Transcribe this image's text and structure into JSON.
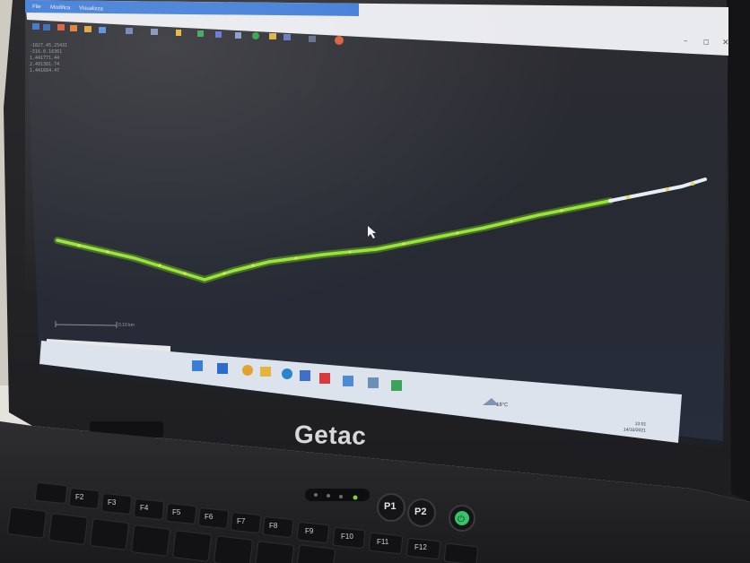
{
  "laptop": {
    "brand": "Getac",
    "screen": {
      "menu": [
        "File",
        "Modifica",
        "Visualizza"
      ],
      "coordinates": [
        "-1827.45.25431",
        "-516.0.16361",
        "1.441771.44",
        "2.491381.74",
        "1.441684.47"
      ],
      "scale_bar_label": "0.10 km",
      "taskbar": {
        "weather": "18°C",
        "clock_time": "13:01",
        "clock_date": "14/10/2021"
      },
      "profile_line_color": "#9be23a",
      "end_segment_color": "#e8eef8"
    },
    "keys": {
      "p_keys": [
        "P1",
        "P2"
      ],
      "function_keys": [
        "F2",
        "F3",
        "F4",
        "F5",
        "F6",
        "F7",
        "F8",
        "F9",
        "F10",
        "F11",
        "F12"
      ]
    }
  }
}
